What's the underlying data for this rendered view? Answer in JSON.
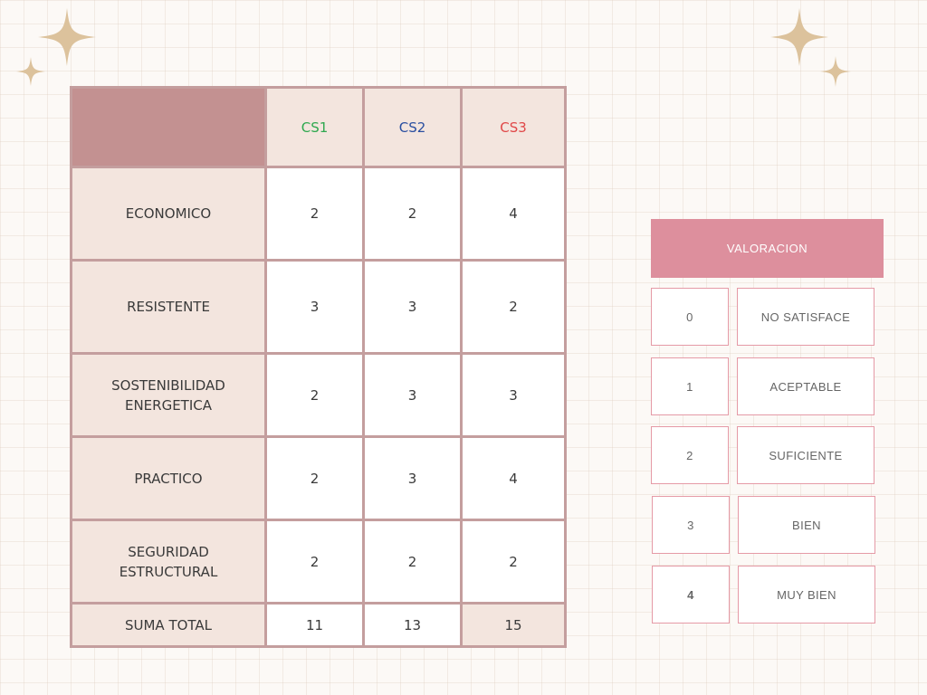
{
  "colors": {
    "table_border": "#c49e9e",
    "corner_fill": "#c39191",
    "label_fill": "#f3e5de",
    "rating_header_fill": "#dd8f9d",
    "rating_border": "#e59aa6",
    "sparkle": "#dcc29c"
  },
  "table": {
    "headers": [
      {
        "label": "CS1",
        "color": "#2fa84f"
      },
      {
        "label": "CS2",
        "color": "#2a4fa0"
      },
      {
        "label": "CS3",
        "color": "#e04848"
      }
    ],
    "rows": [
      {
        "label": "ECONOMICO",
        "values": [
          "2",
          "2",
          "4"
        ]
      },
      {
        "label": "RESISTENTE",
        "values": [
          "3",
          "3",
          "2"
        ]
      },
      {
        "label": "SOSTENIBILIDAD ENERGETICA",
        "values": [
          "2",
          "3",
          "3"
        ]
      },
      {
        "label": "PRACTICO",
        "values": [
          "2",
          "3",
          "4"
        ]
      },
      {
        "label": "SEGURIDAD ESTRUCTURAL",
        "values": [
          "2",
          "2",
          "2"
        ]
      }
    ],
    "total": {
      "label": "SUMA TOTAL",
      "values": [
        "11",
        "13",
        "15"
      ]
    }
  },
  "rating": {
    "title": "VALORACION",
    "items": [
      {
        "score": "0",
        "label": "NO SATISFACE"
      },
      {
        "score": "1",
        "label": "ACEPTABLE"
      },
      {
        "score": "2",
        "label": "SUFICIENTE"
      },
      {
        "score": "3",
        "label": "BIEN"
      },
      {
        "score": "4",
        "label": "MUY BIEN"
      }
    ]
  }
}
